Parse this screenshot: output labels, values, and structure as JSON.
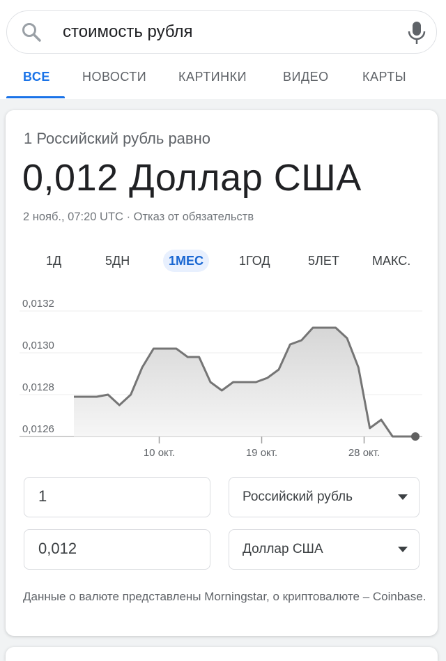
{
  "search": {
    "query": "стоимость рубля"
  },
  "tabs": [
    {
      "label": "ВСЕ",
      "active": true
    },
    {
      "label": "НОВОСТИ",
      "active": false
    },
    {
      "label": "КАРТИНКИ",
      "active": false
    },
    {
      "label": "ВИДЕО",
      "active": false
    },
    {
      "label": "КАРТЫ",
      "active": false
    }
  ],
  "converter": {
    "lead": "1 Российский рубль равно",
    "result": "0,012 Доллар США",
    "timestamp": "2 нояб., 07:20 UTC",
    "separator": " · ",
    "disclaimer": "Отказ от обязательств",
    "ranges": [
      {
        "label": "1Д",
        "active": false
      },
      {
        "label": "5ДН",
        "active": false
      },
      {
        "label": "1МЕС",
        "active": true
      },
      {
        "label": "1ГОД",
        "active": false
      },
      {
        "label": "5ЛЕТ",
        "active": false
      },
      {
        "label": "МАКС.",
        "active": false
      }
    ],
    "amount_from": "1",
    "currency_from": "Российский рубль",
    "amount_to": "0,012",
    "currency_to": "Доллар США",
    "source": "Данные о валюте представлены Morningstar, о криптовалюте – Coinbase."
  },
  "chart_data": {
    "type": "area",
    "title": "",
    "xlabel": "",
    "ylabel": "",
    "x_tick_labels": [
      "10 окт.",
      "19 окт.",
      "28 окт."
    ],
    "y_tick_labels": [
      "0,0132",
      "0,0130",
      "0,0128",
      "0,0126"
    ],
    "y_ticks": [
      0.0132,
      0.013,
      0.0128,
      0.0126
    ],
    "ylim": [
      0.0126,
      0.0132
    ],
    "grid": true,
    "line_color": "#757575",
    "fill_color": "#e0e0e0",
    "values": [
      0.01279,
      0.01279,
      0.01279,
      0.0128,
      0.01275,
      0.0128,
      0.01293,
      0.01302,
      0.01302,
      0.01302,
      0.01298,
      0.01298,
      0.01286,
      0.01282,
      0.01286,
      0.01286,
      0.01286,
      0.01288,
      0.01292,
      0.01304,
      0.01306,
      0.01312,
      0.01312,
      0.01312,
      0.01307,
      0.01293,
      0.01264,
      0.01268,
      0.0126,
      0.0126,
      0.0126
    ],
    "x_tick_indices": [
      7.5,
      16.5,
      25.5
    ]
  }
}
